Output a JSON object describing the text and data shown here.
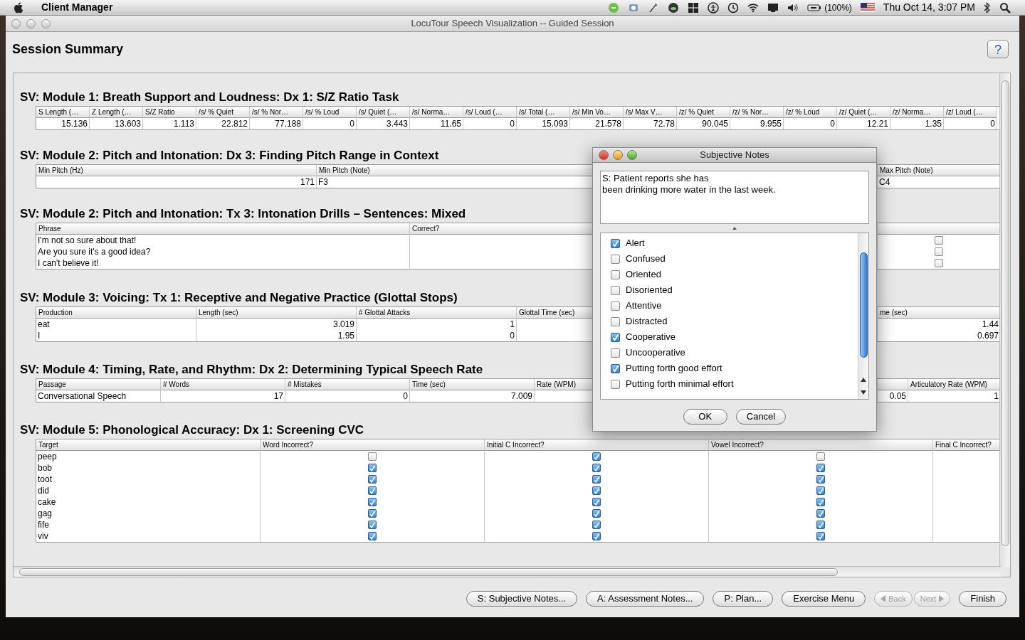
{
  "menubar": {
    "app_name": "Client Manager",
    "battery": "(100%)",
    "clock": "Thu Oct 14,  3:07 PM"
  },
  "window": {
    "title": "LocuTour Speech Visualization -- Guided Session"
  },
  "header": {
    "title": "Session Summary",
    "help": "?"
  },
  "sections": [
    {
      "title": "SV: Module 1: Breath Support and Loudness: Dx 1: S/Z Ratio Task",
      "columns": [
        {
          "label": "S Length (…",
          "kind": "number",
          "cells": [
            "15.136"
          ]
        },
        {
          "label": "Z Length (…",
          "kind": "number",
          "cells": [
            "13.603"
          ]
        },
        {
          "label": "S/Z Ratio",
          "kind": "number",
          "cells": [
            "1.113"
          ]
        },
        {
          "label": "/s/ % Quiet",
          "kind": "number",
          "cells": [
            "22.812"
          ]
        },
        {
          "label": "/s/ % Nor…",
          "kind": "number",
          "cells": [
            "77.188"
          ]
        },
        {
          "label": "/s/ % Loud",
          "kind": "number",
          "cells": [
            "0"
          ]
        },
        {
          "label": "/s/ Quiet (…",
          "kind": "number",
          "cells": [
            "3.443"
          ]
        },
        {
          "label": "/s/ Norma…",
          "kind": "number",
          "cells": [
            "11.65"
          ]
        },
        {
          "label": "/s/ Loud (…",
          "kind": "number",
          "cells": [
            "0"
          ]
        },
        {
          "label": "/s/ Total (…",
          "kind": "number",
          "cells": [
            "15.093"
          ]
        },
        {
          "label": "/s/ Min Vo…",
          "kind": "number",
          "cells": [
            "21.578"
          ]
        },
        {
          "label": "/s/ Max V…",
          "kind": "number",
          "cells": [
            "72.78"
          ]
        },
        {
          "label": "/z/ % Quiet",
          "kind": "number",
          "cells": [
            "90.045"
          ]
        },
        {
          "label": "/z/ % Nor…",
          "kind": "number",
          "cells": [
            "9.955"
          ]
        },
        {
          "label": "/z/ % Loud",
          "kind": "number",
          "cells": [
            "0"
          ]
        },
        {
          "label": "/z/ Quiet (…",
          "kind": "number",
          "cells": [
            "12.21"
          ]
        },
        {
          "label": "/z/ Norma…",
          "kind": "number",
          "cells": [
            "1.35"
          ]
        },
        {
          "label": "/z/ Loud (…",
          "kind": "number",
          "cells": [
            "0"
          ]
        }
      ]
    },
    {
      "title": "SV: Module 2: Pitch and Intonation: Dx 3: Finding Pitch Range in Context",
      "columns": [
        {
          "label": "Min Pitch (Hz)",
          "kind": "number",
          "cells": [
            "171"
          ]
        },
        {
          "label": "Min Pitch (Note)",
          "kind": "text",
          "cells": [
            "F3"
          ]
        },
        {
          "label": "Max Pitch (Note)",
          "kind": "text",
          "cells": [
            "C4"
          ]
        }
      ]
    },
    {
      "title": "SV: Module 2: Pitch and Intonation: Tx 3: Intonation Drills – Sentences: Mixed",
      "columns": [
        {
          "label": "Phrase",
          "kind": "text",
          "cells": [
            "I'm not so sure about that!",
            "Are you sure it's a good idea?",
            "I can't believe it!"
          ]
        },
        {
          "label": "Correct?",
          "kind": "text"
        },
        {
          "kind": "checkbox",
          "cells": [
            {
              "checked": false
            },
            {
              "checked": false
            },
            {
              "checked": false
            }
          ]
        }
      ]
    },
    {
      "title": "SV: Module 3: Voicing: Tx 1: Receptive and Negative Practice (Glottal Stops)",
      "columns": [
        {
          "label": "Production",
          "kind": "text",
          "cells": [
            "eat",
            "I"
          ]
        },
        {
          "label": "Length (sec)",
          "kind": "number",
          "cells": [
            "3.019",
            "1.95"
          ]
        },
        {
          "label": "# Glottal Attacks",
          "kind": "number",
          "cells": [
            "1",
            "0"
          ]
        },
        {
          "label": "Glottal Time (sec)",
          "kind": "number"
        },
        {
          "label": "me (sec)",
          "kind": "number",
          "cells": [
            "1.44",
            "0.697"
          ]
        }
      ]
    },
    {
      "title": "SV: Module 4: Timing, Rate, and Rhythm: Dx 2: Determining Typical Speech Rate",
      "columns": [
        {
          "label": "Passage",
          "kind": "text",
          "cells": [
            "Conversational Speech"
          ]
        },
        {
          "label": "# Words",
          "kind": "number",
          "cells": [
            "17"
          ]
        },
        {
          "label": "# Mistakes",
          "kind": "number",
          "cells": [
            "0"
          ]
        },
        {
          "label": "Time (sec)",
          "kind": "number",
          "cells": [
            "7.009"
          ]
        },
        {
          "label": "Rate (WPM)",
          "kind": "number"
        },
        {
          "kind": "number",
          "cells": [
            "0.05"
          ]
        },
        {
          "label": "Articulatory Rate (WPM)",
          "kind": "number",
          "cells": [
            "1"
          ]
        }
      ]
    },
    {
      "title": "SV: Module 5: Phonological Accuracy: Dx 1: Screening CVC",
      "columns": [
        {
          "label": "Target",
          "kind": "text",
          "cells": [
            "peep",
            "bob",
            "toot",
            "did",
            "cake",
            "gag",
            "fife",
            "viv"
          ]
        },
        {
          "label": "Word Incorrect?",
          "kind": "checkbox",
          "cells": [
            {
              "checked": false
            },
            {
              "checked": true
            },
            {
              "checked": true
            },
            {
              "checked": true
            },
            {
              "checked": true
            },
            {
              "checked": true
            },
            {
              "checked": true
            },
            {
              "checked": true
            }
          ]
        },
        {
          "label": "Initial C Incorrect?",
          "kind": "checkbox",
          "cells": [
            {
              "checked": true
            },
            {
              "checked": true
            },
            {
              "checked": true
            },
            {
              "checked": true
            },
            {
              "checked": true
            },
            {
              "checked": true
            },
            {
              "checked": true
            },
            {
              "checked": true
            }
          ]
        },
        {
          "label": "Vowel Incorrect?",
          "kind": "checkbox",
          "cells": [
            {
              "checked": false
            },
            {
              "checked": true
            },
            {
              "checked": true
            },
            {
              "checked": true
            },
            {
              "checked": true
            },
            {
              "checked": true
            },
            {
              "checked": true
            },
            {
              "checked": true
            }
          ]
        },
        {
          "label": "Final C Incorrect?",
          "kind": "text"
        }
      ]
    }
  ],
  "buttons": [
    {
      "label": "S: Subjective Notes...",
      "kind": "plain",
      "disabled": false
    },
    {
      "label": "A: Assessment Notes...",
      "kind": "plain",
      "disabled": false
    },
    {
      "label": "P: Plan...",
      "kind": "plain",
      "disabled": false
    },
    {
      "label": "Exercise Menu",
      "kind": "plain",
      "disabled": false
    },
    {
      "label": "Back",
      "kind": "back",
      "disabled": true
    },
    {
      "label": "Next",
      "kind": "next",
      "disabled": true
    },
    {
      "label": "Finish",
      "kind": "plain",
      "disabled": false
    }
  ],
  "dialog": {
    "title": "Subjective Notes",
    "notes": "S: Patient reports she has\nbeen drinking more water in the last week.",
    "options": [
      {
        "label": "Alert",
        "checked": true
      },
      {
        "label": "Confused",
        "checked": false
      },
      {
        "label": "Oriented",
        "checked": false
      },
      {
        "label": "Disoriented",
        "checked": false
      },
      {
        "label": "Attentive",
        "checked": false
      },
      {
        "label": "Distracted",
        "checked": false
      },
      {
        "label": "Cooperative",
        "checked": true
      },
      {
        "label": "Uncooperative",
        "checked": false
      },
      {
        "label": "Putting forth good effort",
        "checked": true
      },
      {
        "label": "Putting forth minimal effort",
        "checked": false
      }
    ],
    "buttons": [
      "OK",
      "Cancel"
    ]
  }
}
